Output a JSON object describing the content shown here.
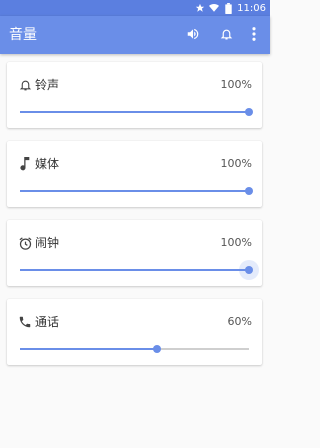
{
  "status_bar": {
    "time": "11:06",
    "icons": [
      "star-icon",
      "wifi-icon",
      "battery-icon"
    ]
  },
  "app_bar": {
    "title": "音量",
    "actions": [
      "volume-icon",
      "bell-icon",
      "more-vert-icon"
    ]
  },
  "colors": {
    "primary": "#6a8ee8",
    "status_bar": "#5b7fe0",
    "track": "#cfcfcf"
  },
  "volumes": [
    {
      "label": "铃声",
      "value_text": "100%",
      "level": 1.0,
      "icon": "bell-icon"
    },
    {
      "label": "媒体",
      "value_text": "100%",
      "level": 1.0,
      "icon": "music-note-icon"
    },
    {
      "label": "闹钟",
      "value_text": "100%",
      "level": 1.0,
      "icon": "alarm-clock-icon",
      "focused": true
    },
    {
      "label": "通话",
      "value_text": "60%",
      "level": 0.6,
      "icon": "phone-icon"
    }
  ]
}
